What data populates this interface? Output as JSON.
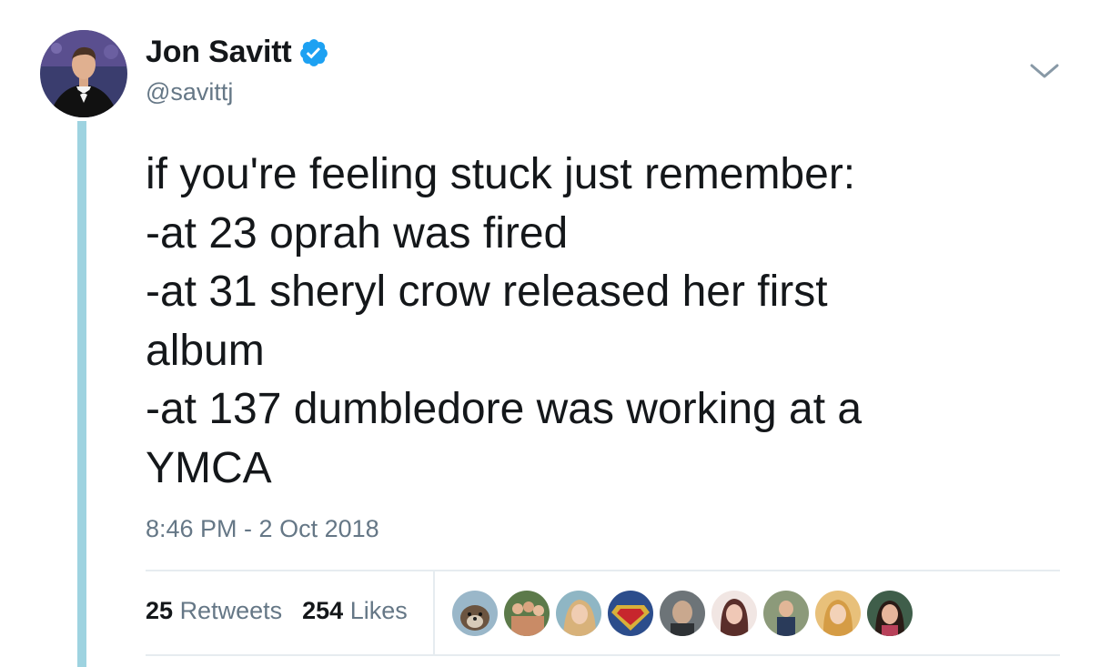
{
  "author": {
    "display_name": "Jon Savitt",
    "handle": "@savittj",
    "verified": true,
    "avatar_icon": "profile-photo"
  },
  "tweet": {
    "lines": [
      "if you're feeling stuck just remember:",
      "-at 23 oprah was fired",
      "-at 31 sheryl crow released her first",
      "album",
      "-at 137 dumbledore was working at a",
      "YMCA"
    ],
    "timestamp": "8:46 PM - 2 Oct 2018"
  },
  "stats": {
    "retweets_count": "25",
    "retweets_label": "Retweets",
    "likes_count": "254",
    "likes_label": "Likes"
  },
  "likers": [
    {
      "icon": "otter-avatar"
    },
    {
      "icon": "group-avatar"
    },
    {
      "icon": "person-avatar"
    },
    {
      "icon": "superman-avatar"
    },
    {
      "icon": "person-avatar"
    },
    {
      "icon": "person-avatar"
    },
    {
      "icon": "person-avatar"
    },
    {
      "icon": "person-avatar"
    },
    {
      "icon": "person-avatar"
    }
  ],
  "colors": {
    "verified": "#1da1f2",
    "thread_line": "#9ed3e0",
    "secondary_text": "#657786",
    "primary_text": "#14171a"
  },
  "icons": {
    "menu_caret": "chevron-down-icon",
    "verified_badge": "verified-badge-icon"
  }
}
